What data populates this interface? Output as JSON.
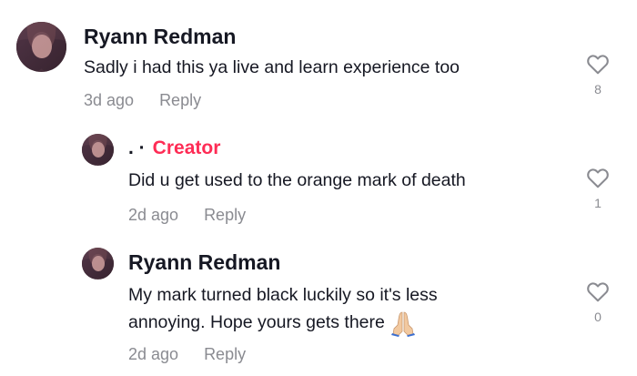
{
  "comments": [
    {
      "username": "Ryann Redman",
      "text_lines": [
        "Sadly i had this ya live and learn experience too"
      ],
      "time": "3d ago",
      "reply_label": "Reply",
      "likes": "8"
    },
    {
      "username_dots": ". ·",
      "creator_label": "Creator",
      "text_lines": [
        "Did u get used to the orange mark of death"
      ],
      "time": "2d ago",
      "reply_label": "Reply",
      "likes": "1"
    },
    {
      "username": "Ryann Redman",
      "text_lines": [
        "My mark turned black luckily so it's less",
        "annoying. Hope yours gets there"
      ],
      "emoji": "folded-hands",
      "time": "2d ago",
      "reply_label": "Reply",
      "likes": "0"
    }
  ],
  "icons": {
    "like": "heart-outline-icon"
  },
  "colors": {
    "creator_badge": "#fe2c55",
    "meta_text": "#8a8b91",
    "primary_text": "#161823"
  }
}
